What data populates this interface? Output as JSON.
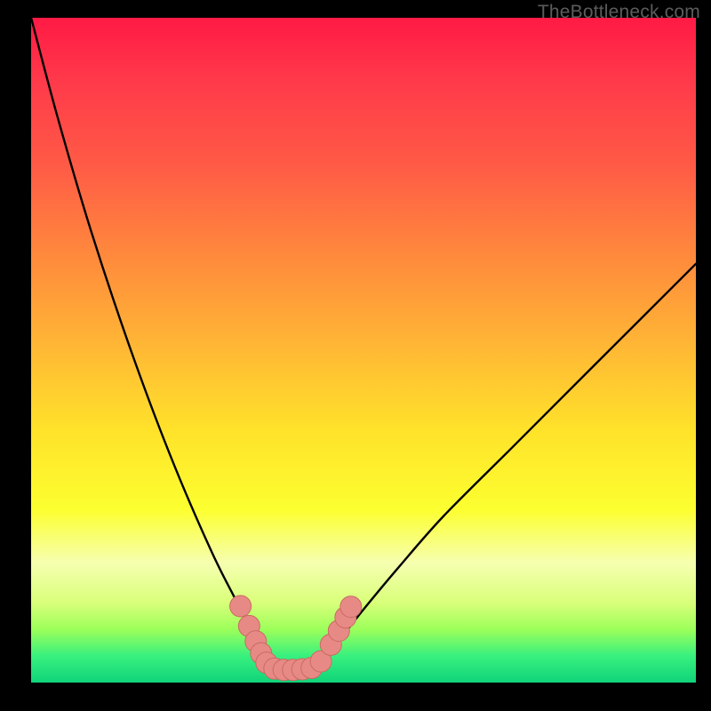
{
  "watermark": "TheBottleneck.com",
  "colors": {
    "curve": "#000000",
    "marker_fill": "#e78a85",
    "marker_stroke": "#c96b64",
    "bg_black": "#000000"
  },
  "chart_data": {
    "type": "line",
    "title": "",
    "xlabel": "",
    "ylabel": "",
    "xlim": [
      0,
      100
    ],
    "ylim": [
      0,
      100
    ],
    "grid": false,
    "legend": false,
    "note": "Axes have no visible tick labels; x and y expressed as 0–100 relative plot-area coordinates (0,0 = top-left). Curve dips to ~y=98 near x≈38 and rises again; right branch ends near y≈37 at x=100.",
    "series": [
      {
        "name": "bottleneck-curve",
        "x": [
          0,
          4,
          9,
          15,
          21,
          27,
          31,
          34,
          37,
          40,
          43,
          46,
          50,
          55,
          62,
          72,
          84,
          100
        ],
        "y": [
          0,
          15,
          32,
          50,
          66,
          80,
          88,
          94,
          97,
          98,
          97,
          94,
          89,
          83,
          75,
          65,
          53,
          37
        ]
      }
    ],
    "markers": {
      "name": "highlight-cluster",
      "points": [
        {
          "x": 31.5,
          "y": 88.5,
          "r": 1.6
        },
        {
          "x": 32.8,
          "y": 91.5,
          "r": 1.6
        },
        {
          "x": 33.8,
          "y": 93.8,
          "r": 1.6
        },
        {
          "x": 34.6,
          "y": 95.6,
          "r": 1.6
        },
        {
          "x": 35.4,
          "y": 97.0,
          "r": 1.6
        },
        {
          "x": 36.6,
          "y": 97.9,
          "r": 1.6
        },
        {
          "x": 38.0,
          "y": 98.1,
          "r": 1.6
        },
        {
          "x": 39.4,
          "y": 98.1,
          "r": 1.6
        },
        {
          "x": 40.8,
          "y": 98.0,
          "r": 1.6
        },
        {
          "x": 42.2,
          "y": 97.8,
          "r": 1.6
        },
        {
          "x": 43.6,
          "y": 96.8,
          "r": 1.6
        },
        {
          "x": 45.1,
          "y": 94.3,
          "r": 1.6
        },
        {
          "x": 46.3,
          "y": 92.2,
          "r": 1.6
        },
        {
          "x": 47.3,
          "y": 90.2,
          "r": 1.6
        },
        {
          "x": 48.1,
          "y": 88.6,
          "r": 1.6
        }
      ]
    }
  }
}
